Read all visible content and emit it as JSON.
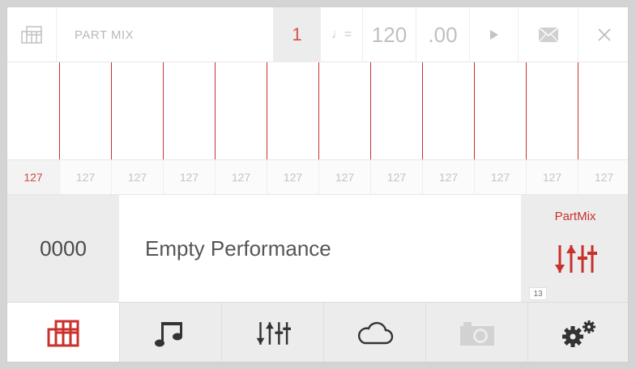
{
  "topbar": {
    "mode_icon": "keyboard-parts-icon",
    "title": "PART MIX",
    "part_number": "1",
    "tempo_symbol": "♩=",
    "tempo_whole": "120",
    "tempo_fraction": ".00",
    "play_icon": "play-icon",
    "mail_icon": "envelope-icon",
    "close_icon": "close-icon"
  },
  "faders": {
    "values": [
      "127",
      "127",
      "127",
      "127",
      "127",
      "127",
      "127",
      "127",
      "127",
      "127",
      "127",
      "127"
    ]
  },
  "performance": {
    "number": "0000",
    "name": "Empty Performance",
    "panel_label": "PartMix",
    "panel_icon": "mixer-sliders-icon",
    "badge": "13"
  },
  "nav": {
    "items": [
      {
        "icon": "keyboard-parts-icon",
        "active": true
      },
      {
        "icon": "music-notes-icon",
        "active": false
      },
      {
        "icon": "mixer-sliders-icon",
        "active": false
      },
      {
        "icon": "cloud-icon",
        "active": false
      },
      {
        "icon": "camera-icon",
        "active": false
      },
      {
        "icon": "settings-gears-icon",
        "active": false
      }
    ]
  },
  "colors": {
    "accent_red": "#c8312c",
    "panel_gray": "#ececec",
    "muted_text": "#c4c4c4"
  }
}
